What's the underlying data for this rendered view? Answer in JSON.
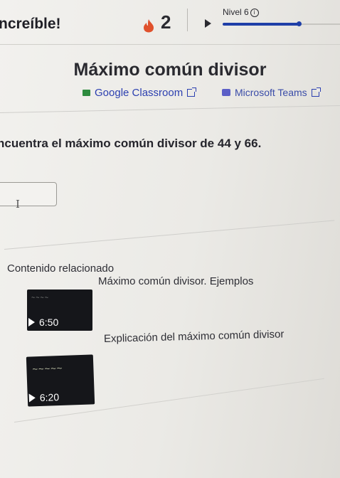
{
  "header": {
    "streak_label": "ncreíble!",
    "streak_count": "2",
    "level_label": "Nivel 6",
    "level_progress": 0.65
  },
  "main": {
    "title": "Máximo común divisor",
    "share": {
      "classroom_label": "Google Classroom",
      "teams_label": "Microsoft Teams"
    },
    "question": "ncuentra el máximo común divisor de 44 y 66.",
    "answer_value": ""
  },
  "related": {
    "heading": "Contenido relacionado",
    "videos": [
      {
        "title": "Máximo común divisor. Ejemplos",
        "duration": "6:50"
      },
      {
        "title": "Explicación del máximo común divisor",
        "duration": "6:20"
      }
    ]
  },
  "colors": {
    "accent": "#1f3fa8",
    "link": "#2b3fb0",
    "flame": "#e0512c"
  }
}
